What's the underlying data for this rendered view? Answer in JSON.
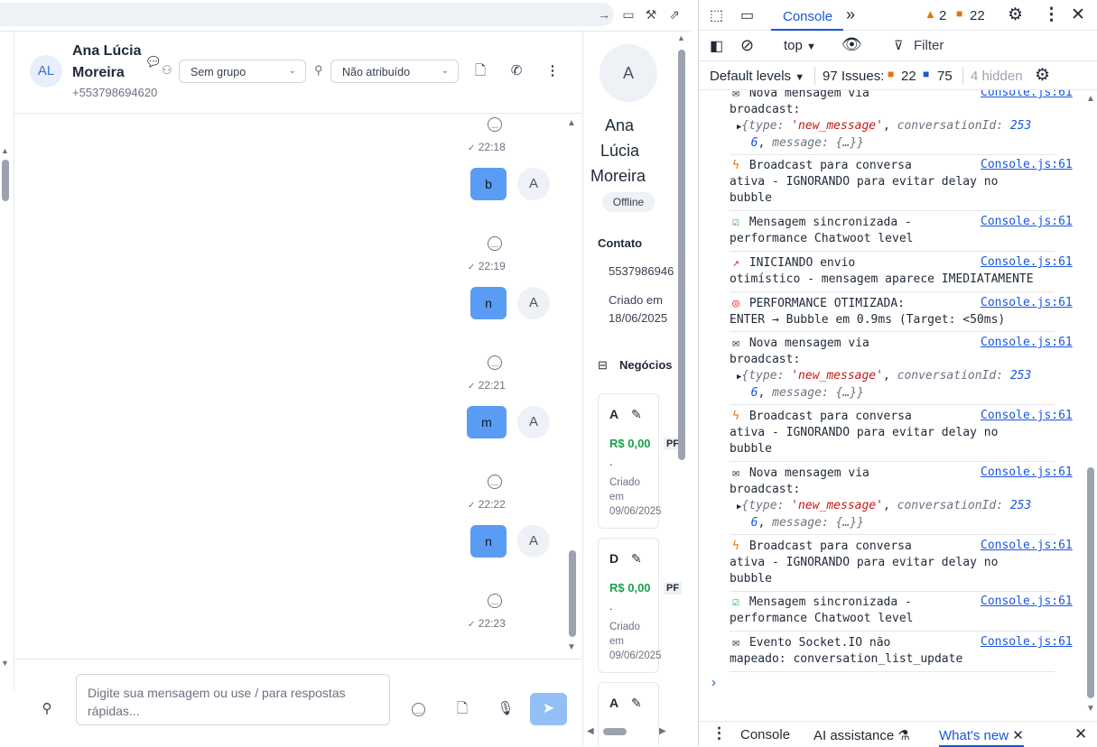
{
  "chat": {
    "contact_name_line1": "Ana Lúcia",
    "contact_name_line2": "Moreira",
    "avatar_initials": "AL",
    "phone": "+553798694620",
    "group_select": "Sem grupo",
    "assignee_select": "Não atribuído",
    "composer_placeholder": "Digite sua mensagem ou use / para respostas rápidas...",
    "messages": [
      {
        "time": "22:18",
        "text": "b",
        "avatar": "A"
      },
      {
        "time": "22:19",
        "text": "n",
        "avatar": "A"
      },
      {
        "time": "22:21",
        "text": "m",
        "avatar": "A"
      },
      {
        "time": "22:22",
        "text": "n",
        "avatar": "A"
      },
      {
        "time": "22:23",
        "text": "",
        "avatar": ""
      }
    ],
    "bubble_color": "#5a9cf3"
  },
  "contact_panel": {
    "avatar": "A",
    "name_line1": "Ana",
    "name_line2": "Lúcia",
    "name_line3": "Moreira",
    "status": "Offline",
    "section_contact": "Contato",
    "phone_partial": "5537986946",
    "created_label": "Criado em",
    "created_date": "18/06/2025",
    "section_deals": "Negócios",
    "deals": [
      {
        "letter": "A",
        "value": "R$ 0,00",
        "tag": "PF",
        "dot": ".",
        "created1": "Criado",
        "created2": "em",
        "created3": "09/06/2025"
      },
      {
        "letter": "D",
        "value": "R$ 0,00",
        "tag": "PF",
        "dot": ".",
        "created1": "Criado",
        "created2": "em",
        "created3": "09/06/2025"
      },
      {
        "letter": "A",
        "value": "",
        "tag": "",
        "dot": "",
        "created1": "",
        "created2": "",
        "created3": ""
      }
    ],
    "value_color": "#16a34a"
  },
  "devtools": {
    "tab_console": "Console",
    "warn_count": "2",
    "error_count": "22",
    "context": "top",
    "filter_placeholder": "Filter",
    "levels": "Default levels",
    "issues_label": "97 Issues:",
    "issues_errors": "22",
    "issues_info": "75",
    "hidden": "4 hidden",
    "source": "Console.js:61",
    "logs": [
      {
        "icon": "envelope",
        "l1": " Nova mensagem via",
        "l2": "broadcast:",
        "obj": true
      },
      {
        "icon": "bolt",
        "l1": " Broadcast para conversa",
        "l2": "ativa - IGNORANDO para evitar delay no",
        "l3": "bubble"
      },
      {
        "icon": "check",
        "l1": " Mensagem sincronizada -",
        "l2": "performance Chatwoot level"
      },
      {
        "icon": "rocket",
        "l1": " INICIANDO envio",
        "l2": "otimístico - mensagem aparece IMEDIATAMENTE"
      },
      {
        "icon": "target",
        "l1": " PERFORMANCE OTIMIZADA:",
        "l2": "ENTER → Bubble em 0.9ms (Target: <50ms)"
      },
      {
        "icon": "envelope",
        "l1": " Nova mensagem via",
        "l2": "broadcast:",
        "obj": true
      },
      {
        "icon": "bolt",
        "l1": " Broadcast para conversa",
        "l2": "ativa - IGNORANDO para evitar delay no",
        "l3": "bubble"
      },
      {
        "icon": "envelope",
        "l1": " Nova mensagem via",
        "l2": "broadcast:",
        "obj": true
      },
      {
        "icon": "bolt",
        "l1": " Broadcast para conversa",
        "l2": "ativa - IGNORANDO para evitar delay no",
        "l3": "bubble"
      },
      {
        "icon": "check",
        "l1": " Mensagem sincronizada -",
        "l2": "performance Chatwoot level"
      },
      {
        "icon": "envelope",
        "l1": " Evento Socket.IO não",
        "l2": "mapeado: conversation_list_update"
      }
    ],
    "obj_type_key": "type",
    "obj_type_val": "'new_message'",
    "obj_conv_key": "conversationId",
    "obj_conv_val1": "253",
    "obj_conv_val2": "6",
    "obj_msg_key": "message",
    "obj_msg_val": "{…}",
    "bottom_tab_console": "Console",
    "bottom_tab_ai": "AI assistance",
    "bottom_tab_whatsnew": "What's new"
  }
}
